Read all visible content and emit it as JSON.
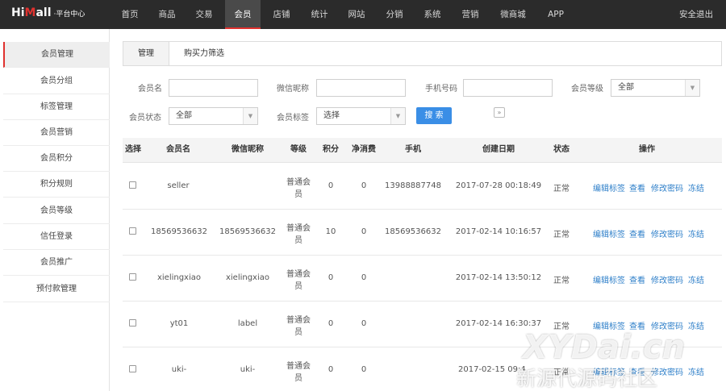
{
  "logo": {
    "main_prefix": "Hi",
    "main_accent": "M",
    "main_suffix": "all",
    "sub": "·平台中心"
  },
  "nav": [
    "首页",
    "商品",
    "交易",
    "会员",
    "店铺",
    "统计",
    "网站",
    "分销",
    "系统",
    "营销",
    "微商城",
    "APP"
  ],
  "nav_active": "会员",
  "logout": "安全退出",
  "sidebar": [
    "会员管理",
    "会员分组",
    "标签管理",
    "会员营销",
    "会员积分",
    "积分规则",
    "会员等级",
    "信任登录",
    "会员推广",
    "预付款管理"
  ],
  "tabs": [
    "管理",
    "购买力筛选"
  ],
  "filters": {
    "member_name": {
      "label": "会员名",
      "value": ""
    },
    "wechat_nick": {
      "label": "微信昵称",
      "value": ""
    },
    "phone": {
      "label": "手机号码",
      "value": ""
    },
    "level": {
      "label": "会员等级",
      "value": "全部"
    },
    "status": {
      "label": "会员状态",
      "value": "全部"
    },
    "tag": {
      "label": "会员标签",
      "value": "选择"
    },
    "search_label": "搜 索"
  },
  "table": {
    "headers": [
      "选择",
      "会员名",
      "微信昵称",
      "等级",
      "积分",
      "净消费",
      "手机",
      "创建日期",
      "状态",
      "操作"
    ],
    "actions": [
      "编辑标签",
      "查看",
      "修改密码",
      "冻结"
    ],
    "rows": [
      {
        "name": "seller",
        "nick": "",
        "level_1": "普通会",
        "level_2": "员",
        "points": "0",
        "spend": "0",
        "phone": "13988887748",
        "created": "2017-07-28 00:18:49",
        "status": "正常"
      },
      {
        "name": "18569536632",
        "nick": "18569536632",
        "level_1": "普通会",
        "level_2": "员",
        "points": "10",
        "spend": "0",
        "phone": "18569536632",
        "created": "2017-02-14 10:16:57",
        "status": "正常"
      },
      {
        "name": "xielingxiao",
        "nick": "xielingxiao",
        "level_1": "普通会",
        "level_2": "员",
        "points": "0",
        "spend": "0",
        "phone": "",
        "created": "2017-02-14 13:50:12",
        "status": "正常"
      },
      {
        "name": "yt01",
        "nick": "label",
        "level_1": "普通会",
        "level_2": "员",
        "points": "0",
        "spend": "0",
        "phone": "",
        "created": "2017-02-14 16:30:37",
        "status": "正常"
      },
      {
        "name": "uki-",
        "nick": "uki-",
        "level_1": "普通会",
        "level_2": "员",
        "points": "0",
        "spend": "0",
        "phone": "",
        "created": "2017-02-15 09:4",
        "status": "正常"
      }
    ]
  },
  "watermark": {
    "line1": "XYDai.cn",
    "line2": "新源代源码社区"
  },
  "colors": {
    "accent": "#e0312e",
    "link": "#2e7fc9",
    "button": "#3a8ee6",
    "nav_bg": "#2b2b2b"
  }
}
